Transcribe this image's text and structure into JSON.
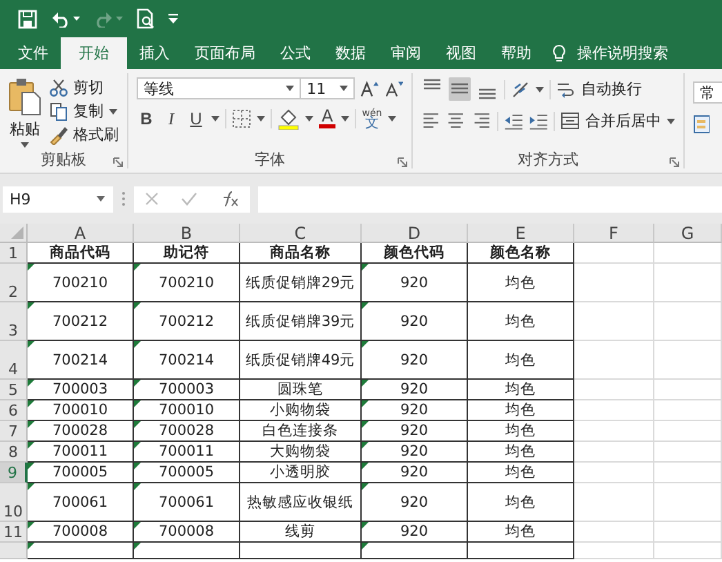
{
  "quick_access": [
    {
      "kind": "save",
      "disabled": false
    },
    {
      "kind": "undo",
      "disabled": false
    },
    {
      "kind": "redo",
      "disabled": true
    },
    {
      "kind": "print_preview",
      "disabled": false
    },
    {
      "kind": "customize",
      "disabled": false
    }
  ],
  "tabs": [
    {
      "label": "文件",
      "selected": false
    },
    {
      "label": "开始",
      "selected": true
    },
    {
      "label": "插入",
      "selected": false
    },
    {
      "label": "页面布局",
      "selected": false
    },
    {
      "label": "公式",
      "selected": false
    },
    {
      "label": "数据",
      "selected": false
    },
    {
      "label": "审阅",
      "selected": false
    },
    {
      "label": "视图",
      "selected": false
    },
    {
      "label": "帮助",
      "selected": false
    }
  ],
  "tell_me": "操作说明搜索",
  "ribbon": {
    "clipboard": {
      "title": "剪贴板",
      "paste": "粘贴",
      "items": [
        {
          "kind": "cut",
          "label": "剪切"
        },
        {
          "kind": "copy",
          "label": "复制"
        },
        {
          "kind": "format_painter",
          "label": "格式刷"
        }
      ]
    },
    "font": {
      "title": "字体",
      "name": "等线",
      "size": "11",
      "bold": "B",
      "italic": "I",
      "underline": "U",
      "font_color": "A",
      "phonetic_top": "wén",
      "phonetic_bottom": "文"
    },
    "alignment": {
      "title": "对齐方式",
      "vertical": [
        {
          "kind": "top",
          "selected": false
        },
        {
          "kind": "middle",
          "selected": true
        },
        {
          "kind": "bottom",
          "selected": false
        }
      ],
      "horizontal": [
        {
          "kind": "left",
          "selected": false
        },
        {
          "kind": "center",
          "selected": false
        },
        {
          "kind": "right",
          "selected": false
        }
      ],
      "wrap": "自动换行",
      "merge": "合并后居中"
    },
    "number": {
      "format": "常"
    }
  },
  "formula_bar": {
    "name_box": "H9"
  },
  "sheet": {
    "columns": [
      {
        "letter": "A",
        "text_flag": true
      },
      {
        "letter": "B",
        "text_flag": true
      },
      {
        "letter": "C",
        "text_flag": false
      },
      {
        "letter": "D",
        "text_flag": true
      },
      {
        "letter": "E",
        "text_flag": false
      },
      {
        "letter": "F",
        "text_flag": false
      },
      {
        "letter": "G",
        "text_flag": false
      }
    ],
    "rows": [
      {
        "number": "1",
        "kind": "header",
        "selected": false,
        "cells": [
          "商品代码",
          "助记符",
          "商品名称",
          "颜色代码",
          "颜色名称"
        ]
      },
      {
        "number": "2",
        "kind": "tall",
        "selected": false,
        "cells": [
          "700210",
          "700210",
          "纸质促销牌29元",
          "920",
          "均色"
        ]
      },
      {
        "number": "3",
        "kind": "tall",
        "selected": false,
        "cells": [
          "700212",
          "700212",
          "纸质促销牌39元",
          "920",
          "均色"
        ]
      },
      {
        "number": "4",
        "kind": "tall",
        "selected": false,
        "cells": [
          "700214",
          "700214",
          "纸质促销牌49元",
          "920",
          "均色"
        ]
      },
      {
        "number": "5",
        "kind": "normal",
        "selected": false,
        "cells": [
          "700003",
          "700003",
          "圆珠笔",
          "920",
          "均色"
        ]
      },
      {
        "number": "6",
        "kind": "normal",
        "selected": false,
        "cells": [
          "700010",
          "700010",
          "小购物袋",
          "920",
          "均色"
        ]
      },
      {
        "number": "7",
        "kind": "normal",
        "selected": false,
        "cells": [
          "700028",
          "700028",
          "白色连接条",
          "920",
          "均色"
        ]
      },
      {
        "number": "8",
        "kind": "normal",
        "selected": false,
        "cells": [
          "700011",
          "700011",
          "大购物袋",
          "920",
          "均色"
        ]
      },
      {
        "number": "9",
        "kind": "normal",
        "selected": true,
        "cells": [
          "700005",
          "700005",
          "小透明胶",
          "920",
          "均色"
        ]
      },
      {
        "number": "10",
        "kind": "tall",
        "selected": false,
        "cells": [
          "700061",
          "700061",
          "热敏感应收银纸",
          "920",
          "均色"
        ]
      },
      {
        "number": "11",
        "kind": "normal",
        "selected": false,
        "cells": [
          "700008",
          "700008",
          "线剪",
          "920",
          "均色"
        ]
      },
      {
        "kind": "partial",
        "selected": false
      }
    ]
  }
}
